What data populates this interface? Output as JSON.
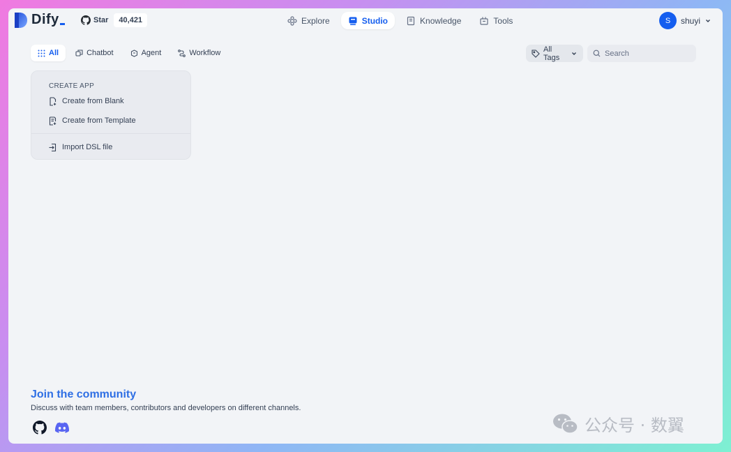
{
  "header": {
    "logo_text": "Dify",
    "github": {
      "star_label": "Star",
      "star_count": "40,421"
    },
    "nav": [
      {
        "label": "Explore",
        "icon": "explore-icon"
      },
      {
        "label": "Studio",
        "icon": "studio-icon",
        "active": true
      },
      {
        "label": "Knowledge",
        "icon": "knowledge-icon"
      },
      {
        "label": "Tools",
        "icon": "tools-icon"
      }
    ],
    "user": {
      "avatar_letter": "S",
      "name": "shuyi"
    }
  },
  "tabs": [
    {
      "label": "All",
      "icon": "grid-icon",
      "active": true
    },
    {
      "label": "Chatbot",
      "icon": "chatbot-icon"
    },
    {
      "label": "Agent",
      "icon": "agent-icon"
    },
    {
      "label": "Workflow",
      "icon": "workflow-icon"
    }
  ],
  "filters": {
    "tags_label": "All Tags",
    "search_placeholder": "Search"
  },
  "create_app": {
    "title": "CREATE APP",
    "blank_label": "Create from Blank",
    "template_label": "Create from Template",
    "import_label": "Import DSL file"
  },
  "community": {
    "title": "Join the community",
    "description": "Discuss with team members, contributors and developers on different channels."
  },
  "watermark": {
    "text": "公众号 · 数翼"
  },
  "colors": {
    "accent": "#155eef",
    "background": "#f2f4f7",
    "community_title": "#2f6fe4"
  }
}
